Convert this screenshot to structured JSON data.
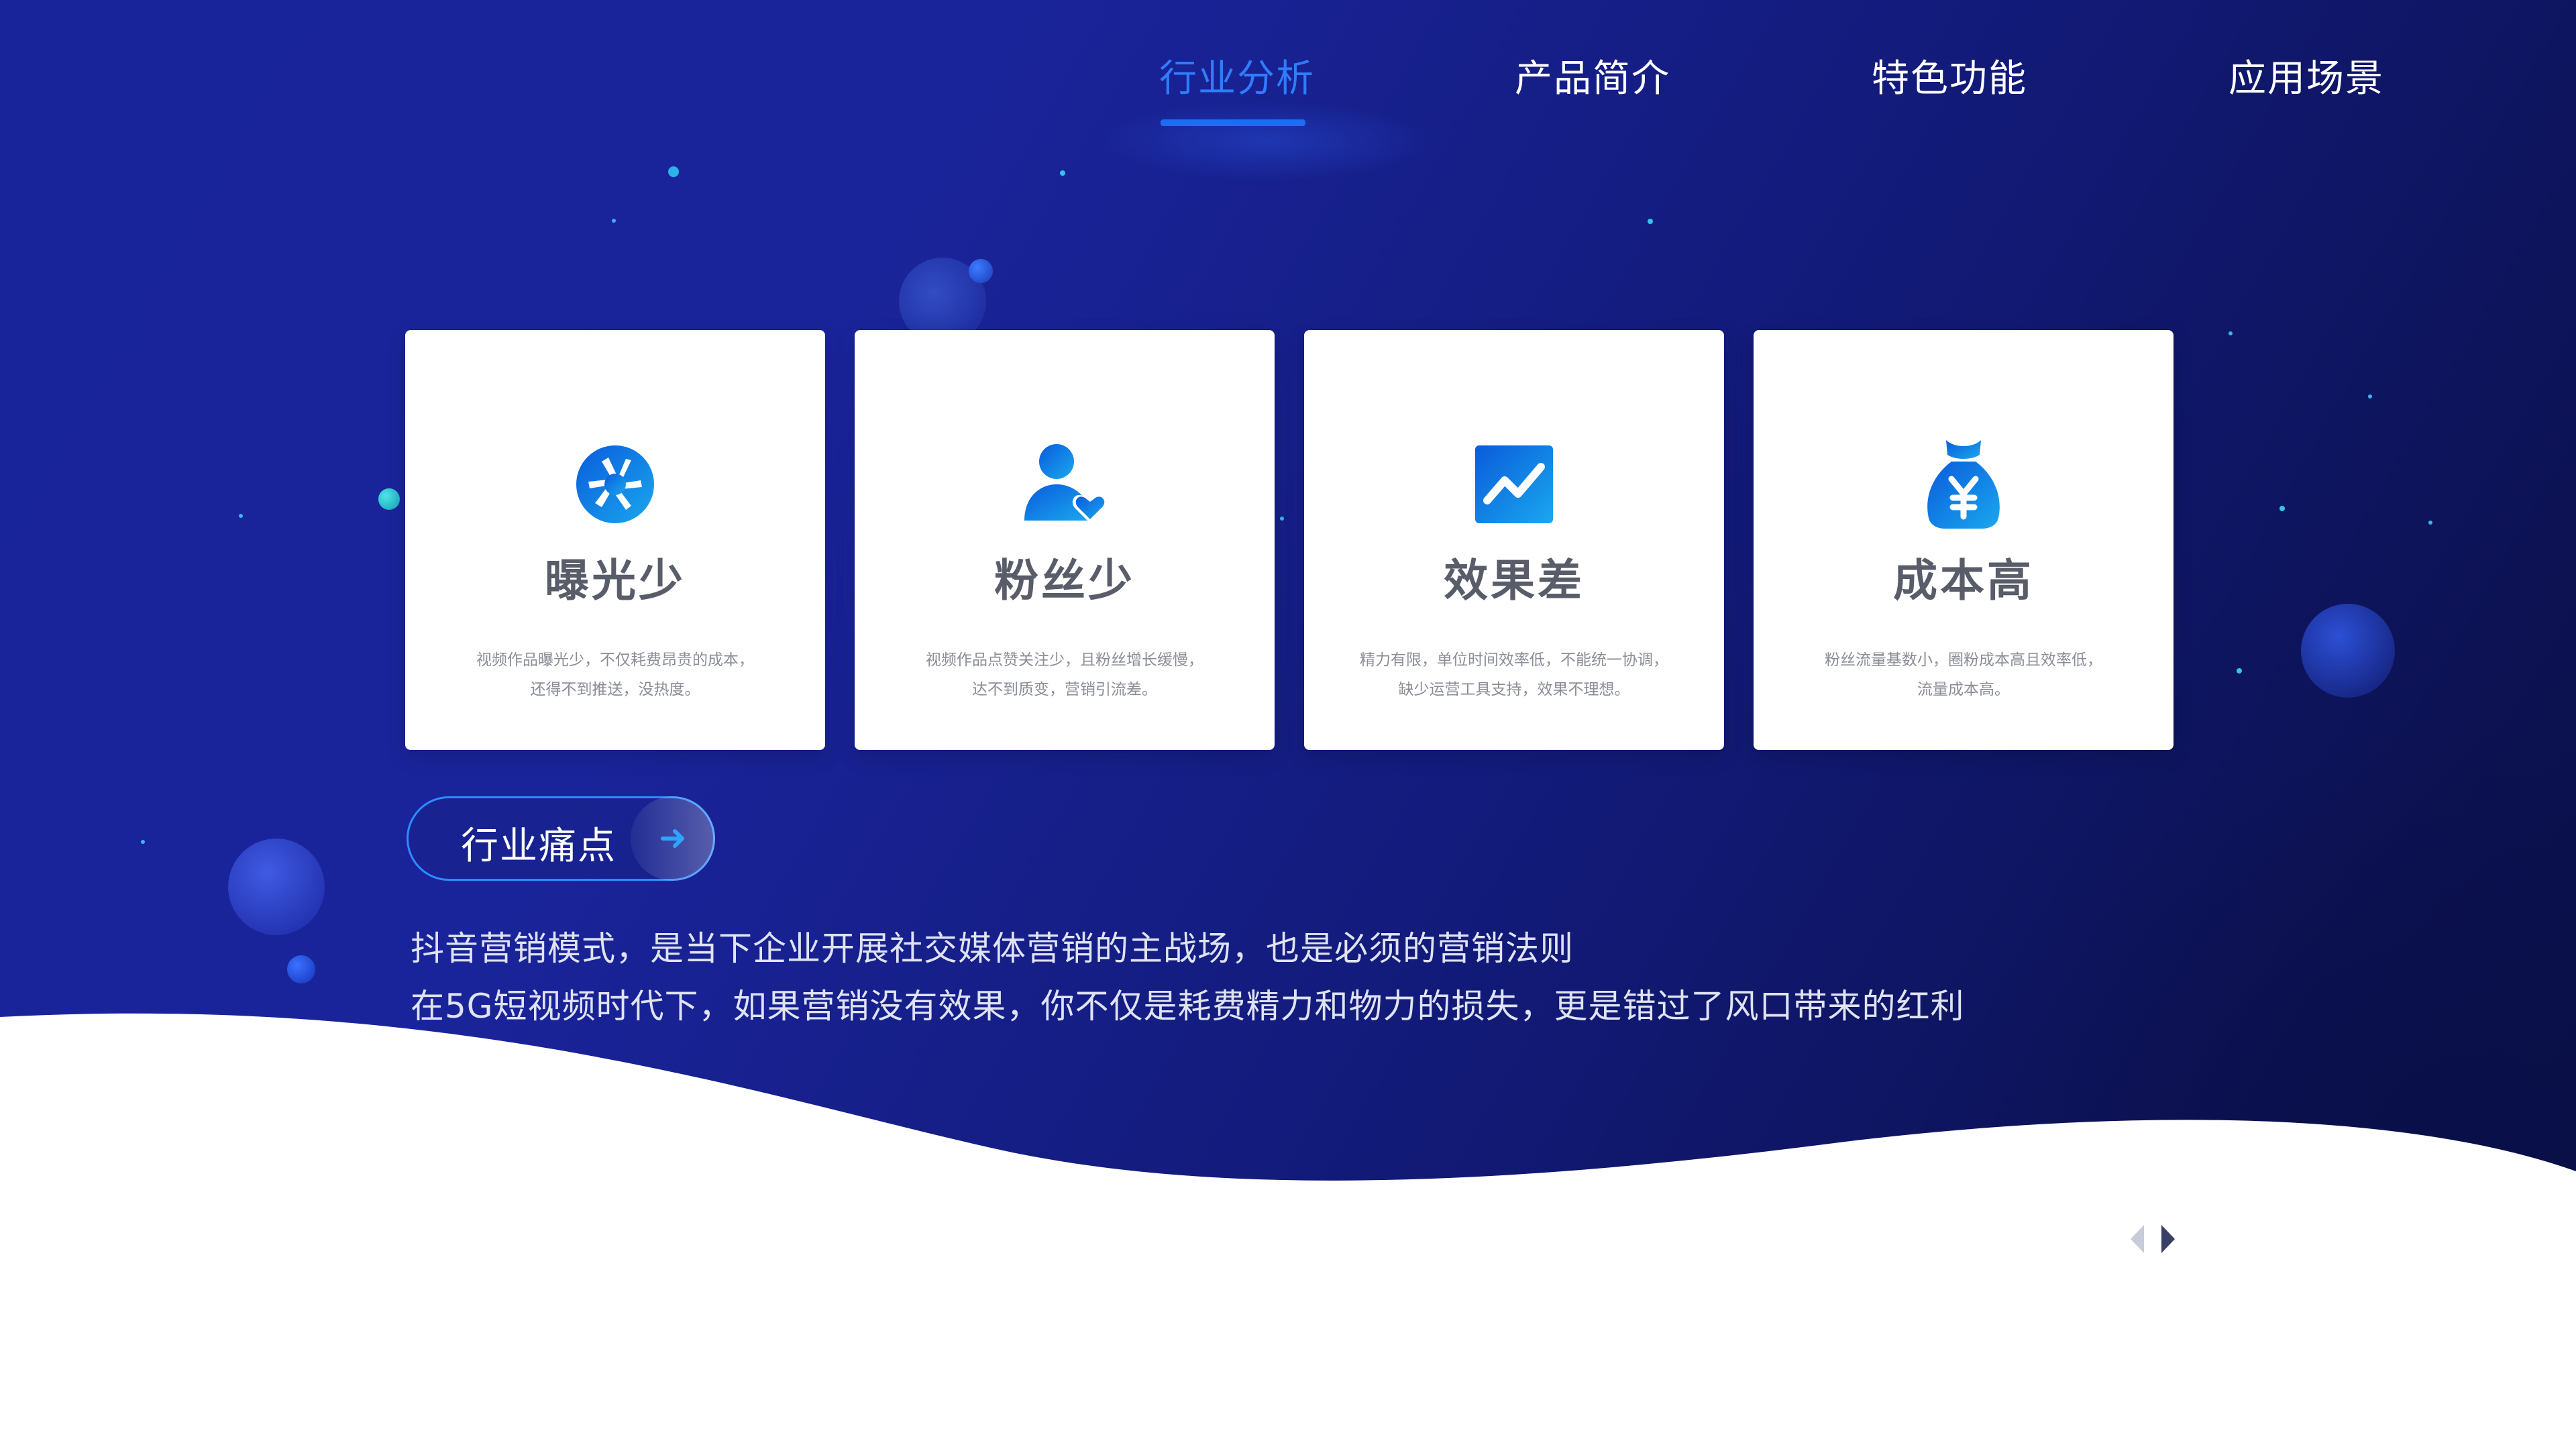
{
  "nav": {
    "items": [
      {
        "label": "行业分析",
        "active": true
      },
      {
        "label": "产品简介",
        "active": false
      },
      {
        "label": "特色功能",
        "active": false
      },
      {
        "label": "应用场景",
        "active": false
      }
    ]
  },
  "cards": [
    {
      "icon": "camera-aperture-icon",
      "title": "曝光少",
      "desc_line1": "视频作品曝光少，不仅耗费昂贵的成本，",
      "desc_line2": "还得不到推送，没热度。"
    },
    {
      "icon": "user-heart-icon",
      "title": "粉丝少",
      "desc_line1": "视频作品点赞关注少，且粉丝增长缓慢，",
      "desc_line2": "达不到质变，营销引流差。"
    },
    {
      "icon": "trend-chart-icon",
      "title": "效果差",
      "desc_line1": "精力有限，单位时间效率低，不能统一协调，",
      "desc_line2": "缺少运营工具支持，效果不理想。"
    },
    {
      "icon": "money-bag-icon",
      "title": "成本高",
      "desc_line1": "粉丝流量基数小，圈粉成本高且效率低，",
      "desc_line2": "流量成本高。"
    }
  ],
  "section_button": {
    "label": "行业痛点",
    "icon": "arrow-right-icon"
  },
  "body": {
    "line1": "抖音营销模式，是当下企业开展社交媒体营销的主战场，也是必须的营销法则",
    "line2": "在5G短视频时代下，如果营销没有效果，你不仅是耗费精力和物力的损失，更是错过了风口带来的红利"
  },
  "pager": {
    "prev_icon": "chevron-left-icon",
    "next_icon": "chevron-right-icon"
  },
  "colors": {
    "primary": "#1f6cf2",
    "accent": "#2f7cff",
    "bg_dark": "#0c1252",
    "bg_blue": "#18249a",
    "card_title": "#595d6a"
  }
}
